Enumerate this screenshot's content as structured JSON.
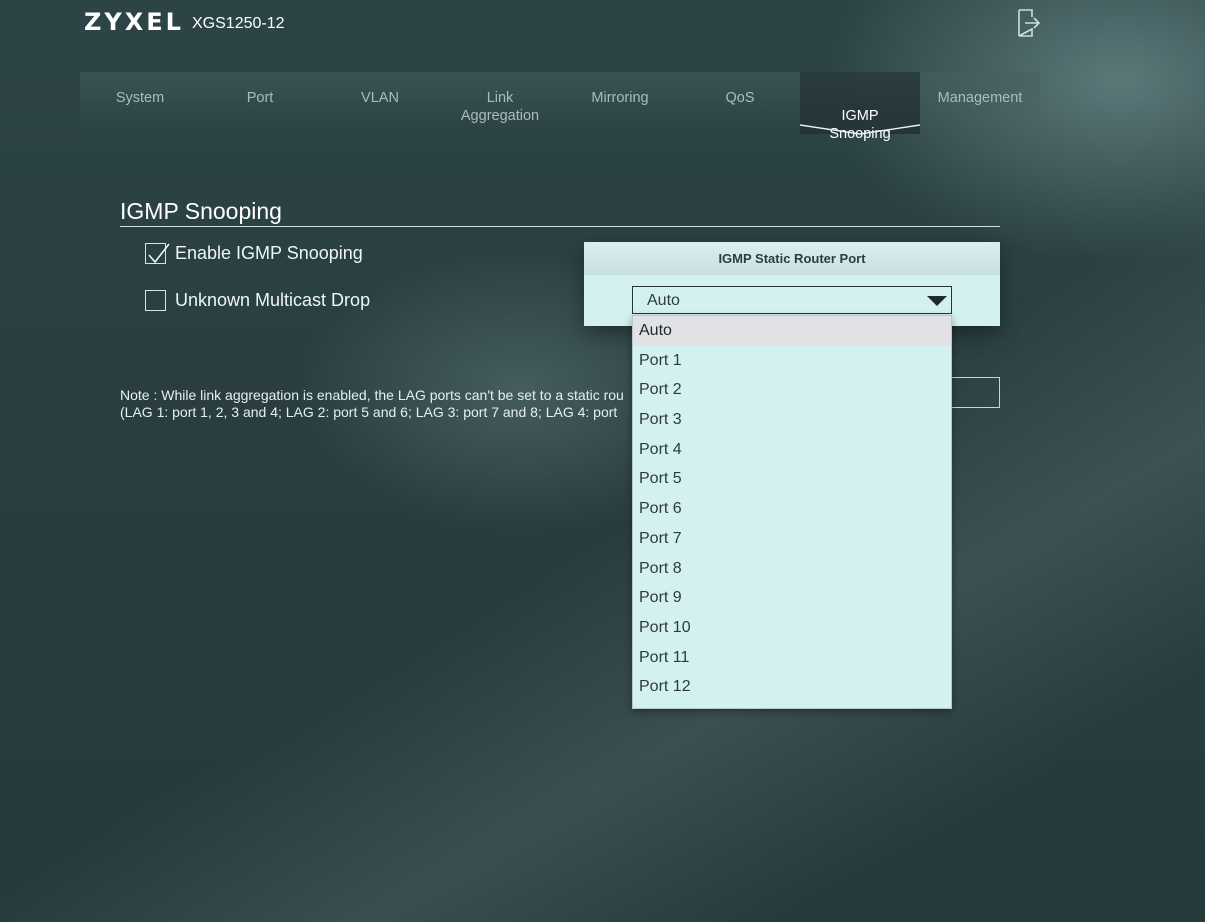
{
  "header": {
    "brand": "ZYXEL",
    "model": "XGS1250-12",
    "logout_icon": "logout-icon"
  },
  "nav": {
    "items": [
      {
        "label": "System"
      },
      {
        "label": "Port"
      },
      {
        "label": "VLAN"
      },
      {
        "label": "Link\nAggregation"
      },
      {
        "label": "Mirroring"
      },
      {
        "label": "QoS"
      },
      {
        "label": "IGMP\nSnooping",
        "active": true
      },
      {
        "label": "Management"
      }
    ]
  },
  "igmp": {
    "title": "IGMP Snooping",
    "enable_label": "Enable IGMP Snooping",
    "enable_checked": true,
    "unknown_drop_label": "Unknown Multicast Drop",
    "unknown_drop_checked": false,
    "router_port_header": "IGMP Static Router Port",
    "router_port_value": "Auto",
    "note_line1": "Note : While link aggregation is enabled, the LAG ports can't be set to a static rou",
    "note_line2": "(LAG 1: port 1, 2, 3 and 4; LAG 2: port 5 and 6; LAG 3: port 7 and 8; LAG 4: port"
  },
  "dropdown": {
    "options": [
      "Auto",
      "Port 1",
      "Port 2",
      "Port 3",
      "Port 4",
      "Port 5",
      "Port 6",
      "Port 7",
      "Port 8",
      "Port 9",
      "Port 10",
      "Port 11",
      "Port 12"
    ],
    "selected": "Auto"
  },
  "colors": {
    "background": "#2b3f41",
    "panel": "#d4f1f1",
    "highlight": "#e2e2e6"
  }
}
